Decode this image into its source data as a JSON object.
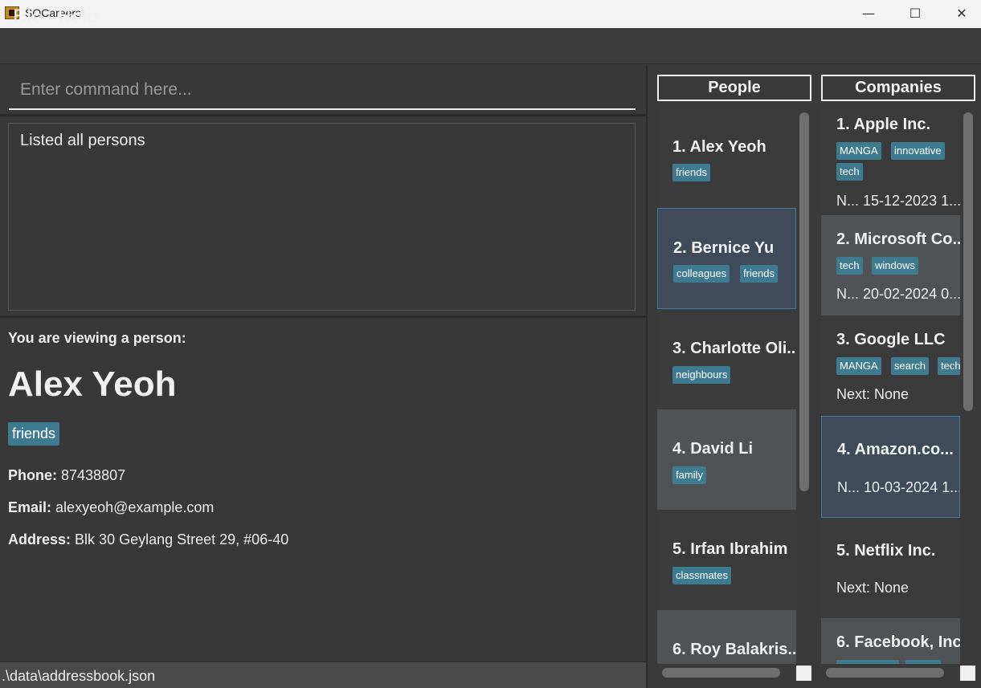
{
  "window": {
    "title": "SOCareers",
    "min_glyph": "—",
    "max_glyph": "☐",
    "close_glyph": "✕"
  },
  "menu": {
    "file": "File",
    "help": "Help"
  },
  "command": {
    "placeholder": "Enter command here..."
  },
  "result": {
    "text": "Listed all persons"
  },
  "detail": {
    "viewing_label": "You are viewing a person:",
    "name": "Alex Yeoh",
    "tag": "friends",
    "phone_label": "Phone:",
    "phone": "87438807",
    "email_label": "Email:",
    "email": "alexyeoh@example.com",
    "address_label": "Address:",
    "address": "Blk 30 Geylang Street 29, #06-40"
  },
  "status": {
    "path": ".\\data\\addressbook.json"
  },
  "people": {
    "header": "People",
    "items": [
      {
        "title": "1.  Alex Yeoh",
        "tags": [
          "friends"
        ]
      },
      {
        "title": "2.  Bernice Yu",
        "tags": [
          "colleagues",
          "friends"
        ]
      },
      {
        "title": "3.  Charlotte Oli...",
        "tags": [
          "neighbours"
        ]
      },
      {
        "title": "4.  David Li",
        "tags": [
          "family"
        ]
      },
      {
        "title": "5.  Irfan Ibrahim",
        "tags": [
          "classmates"
        ]
      },
      {
        "title": "6.  Roy Balakris...",
        "tags": []
      }
    ]
  },
  "companies": {
    "header": "Companies",
    "items": [
      {
        "title": "1.  Apple Inc.",
        "tags": [
          "MANGA",
          "innovative",
          "tech"
        ],
        "next": "N...  15-12-2023 1..."
      },
      {
        "title": "2.  Microsoft Co...",
        "tags": [
          "tech",
          "windows"
        ],
        "next": "N...  20-02-2024 0..."
      },
      {
        "title": "3.  Google LLC",
        "tags": [
          "MANGA",
          "search",
          "tech"
        ],
        "next": "Next: None"
      },
      {
        "title": "4.  Amazon.co...",
        "tags": [],
        "next": "N...  10-03-2024 1..."
      },
      {
        "title": "5.  Netflix Inc.",
        "tags": [],
        "next": "Next: None"
      },
      {
        "title": "6.  Facebook, Inc.",
        "tags": [],
        "next": ""
      }
    ]
  },
  "colors": {
    "background": "#383838",
    "tag": "#3e7b91",
    "selected_card": "#3f4b5a",
    "selected_border": "#3d7c9c"
  }
}
